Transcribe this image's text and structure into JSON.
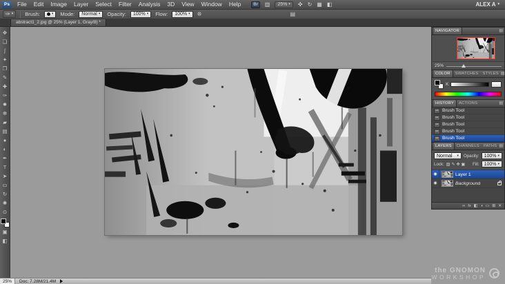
{
  "app": {
    "logo": "Ps",
    "menus": [
      "File",
      "Edit",
      "Image",
      "Layer",
      "Select",
      "Filter",
      "Analysis",
      "3D",
      "View",
      "Window",
      "Help"
    ],
    "bridge_label": "Br",
    "zoom_field": "25%",
    "workspace": "ALEX A"
  },
  "icons": {
    "caret_down": "▾",
    "panel_menu": "▤",
    "view_extras": "▥",
    "hand": "✜",
    "rotate_view": "↻",
    "arrange_documents": "▦",
    "screen_mode": "◧",
    "airbrush": "❊",
    "brush_preset": "✑",
    "history_brush_row": "✑",
    "eye": "◉",
    "lock_transparency": "▨",
    "lock_pixels": "✎",
    "lock_position": "✥",
    "lock_all": "▣",
    "link": "∞",
    "fx": "fx",
    "mask": "◧",
    "adjustment": "◑",
    "group": "▭",
    "new_layer": "⊞",
    "delete_layer": "✕"
  },
  "options": {
    "brush_label": "Brush:",
    "mode_label": "Mode:",
    "mode_value": "Normal",
    "opacity_label": "Opacity:",
    "opacity_value": "100%",
    "flow_label": "Flow:",
    "flow_value": "100%"
  },
  "document": {
    "tab_title": "abstract1_2.jpg @ 25% (Layer 1, Gray/8) *"
  },
  "toolbox": {
    "tools": [
      {
        "name": "move-tool",
        "glyph": "✥"
      },
      {
        "name": "rectangular-marquee-tool",
        "glyph": "❏"
      },
      {
        "name": "lasso-tool",
        "glyph": "ʃ"
      },
      {
        "name": "quick-selection-tool",
        "glyph": "✦"
      },
      {
        "name": "crop-tool",
        "glyph": "❐"
      },
      {
        "name": "eyedropper-tool",
        "glyph": "✎"
      },
      {
        "name": "healing-brush-tool",
        "glyph": "✚"
      },
      {
        "name": "brush-tool",
        "glyph": "✑"
      },
      {
        "name": "clone-stamp-tool",
        "glyph": "✹"
      },
      {
        "name": "history-brush-tool",
        "glyph": "✻"
      },
      {
        "name": "eraser-tool",
        "glyph": "▰"
      },
      {
        "name": "gradient-tool",
        "glyph": "▤"
      },
      {
        "name": "blur-tool",
        "glyph": "●"
      },
      {
        "name": "dodge-tool",
        "glyph": "◐"
      },
      {
        "name": "pen-tool",
        "glyph": "✒"
      },
      {
        "name": "type-tool",
        "glyph": "T"
      },
      {
        "name": "path-selection-tool",
        "glyph": "➤"
      },
      {
        "name": "rectangle-tool",
        "glyph": "▭"
      },
      {
        "name": "rotate-3d-tool",
        "glyph": "↻"
      },
      {
        "name": "hand-tool",
        "glyph": "✺"
      },
      {
        "name": "zoom-tool",
        "glyph": "⊙"
      }
    ]
  },
  "panels": {
    "navigator": {
      "title": "NAVIGATOR",
      "zoom": "25%"
    },
    "color": {
      "tabs": [
        "COLOR",
        "SWATCHES",
        "STYLES"
      ],
      "component_label": "K"
    },
    "history": {
      "tabs": [
        "HISTORY",
        "ACTIONS"
      ],
      "items": [
        "Brush Tool",
        "Brush Tool",
        "Brush Tool",
        "Brush Tool",
        "Brush Tool"
      ],
      "selected_index": 4
    },
    "layers": {
      "tabs": [
        "LAYERS",
        "CHANNELS",
        "PATHS"
      ],
      "blend_mode": "Normal",
      "opacity_label": "Opacity:",
      "opacity_value": "100%",
      "lock_label": "Lock:",
      "fill_label": "Fill:",
      "fill_value": "100%",
      "items": [
        {
          "name": "Layer 1",
          "selected": true,
          "visible": true,
          "locked": false,
          "italic": false
        },
        {
          "name": "Background",
          "selected": false,
          "visible": true,
          "locked": true,
          "italic": true
        }
      ]
    }
  },
  "statusbar": {
    "zoom": "25%",
    "doc_label": "Doc: 7.28M/21.4M"
  },
  "watermark": {
    "line1": "the GNOMON",
    "line2": "WORKSHOP"
  }
}
